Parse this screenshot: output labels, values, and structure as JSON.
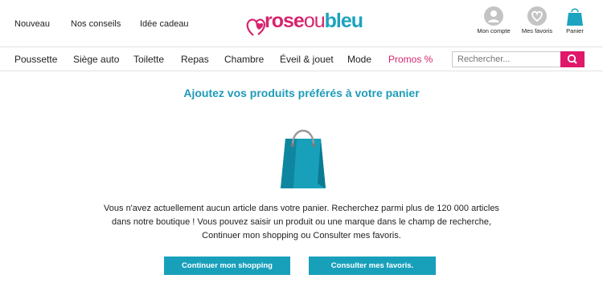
{
  "top_links": [
    "Nouveau",
    "Nos conseils",
    "Idée cadeau"
  ],
  "logo": {
    "part1": "rose",
    "part2": "ou",
    "part3": "bleu"
  },
  "account": {
    "my_account": "Mon compte",
    "favorites": "Mes favoris",
    "cart": "Panier"
  },
  "nav": {
    "items": [
      "Poussette",
      "Siège auto",
      "Toilette",
      "Repas",
      "Chambre",
      "Éveil & jouet",
      "Mode",
      "Promos %"
    ]
  },
  "search": {
    "placeholder": "Rechercher..."
  },
  "main": {
    "heading": "Ajoutez vos produits préférés à votre panier",
    "message_lines": [
      "Vous n'avez actuellement aucun article dans votre panier. Recherchez parmi plus de 120 000 articles",
      "dans notre boutique ! Vous pouvez saisir un produit ou une marque dans le champ de recherche,",
      "Continuer mon shopping ou Consulter mes favoris."
    ],
    "continue_button": "Continuer mon shopping",
    "favorites_button": "Consulter mes favoris."
  },
  "colors": {
    "brand_pink": "#d6246e",
    "brand_teal": "#1ba3bf",
    "button": "#18a0bb",
    "search_button": "#e0186b"
  }
}
